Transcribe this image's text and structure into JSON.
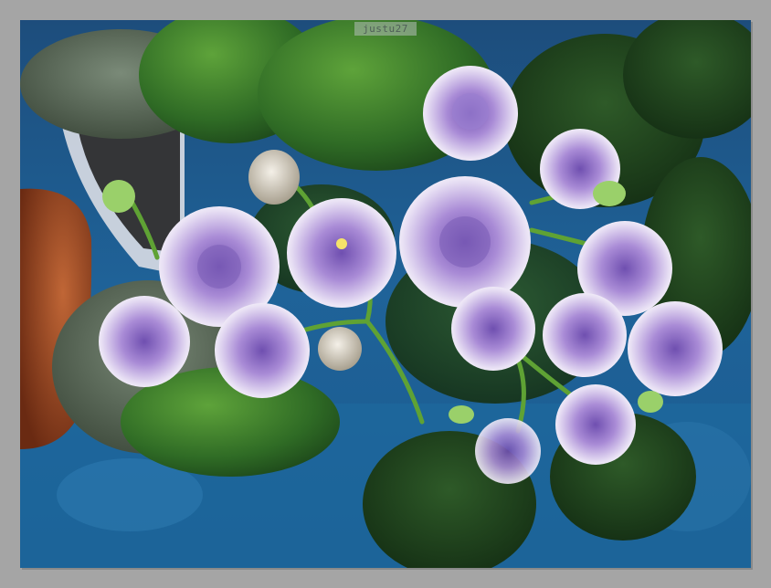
{
  "watermark": "justu27",
  "scene": {
    "subject": "violet-flowers",
    "colors": {
      "frame": "#a5a5a5",
      "background_blue": "#1c5f93",
      "leaf_dark": "#1f4a1c",
      "leaf_light": "#4f9a2e",
      "petal_white": "#f4f0f8",
      "petal_lilac": "#a98bd6",
      "petal_center": "#7d5fb8",
      "pot": "#a0502a"
    }
  }
}
